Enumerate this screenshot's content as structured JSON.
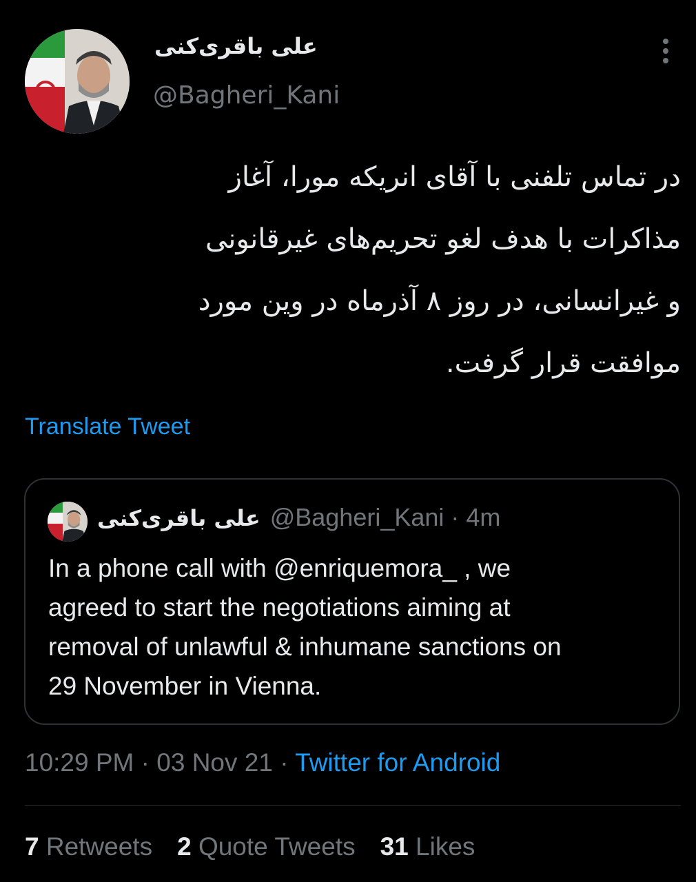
{
  "tweet": {
    "author": {
      "display_name": "علی باقری‌کنی",
      "handle": "@Bagheri_Kani"
    },
    "text_lines": [
      "در تماس تلفنی با آقای انریکه مورا، آغاز",
      "مذاکرات با هدف لغو تحریم‌های غیرقانونی",
      "و غیرانسانی، در روز ۸ آذرماه در وین مورد",
      "موافقت قرار گرفت."
    ],
    "translate_label": "Translate Tweet",
    "quoted": {
      "display_name": "علی باقری‌کنی",
      "handle": "@Bagheri_Kani",
      "separator": "·",
      "time": "4m",
      "text_lines": [
        "In a phone call with @enriquemora_ , we",
        "agreed to start the negotiations aiming at",
        "removal of unlawful & inhumane sanctions on",
        "29 November in Vienna."
      ]
    },
    "meta": {
      "time": "10:29 PM",
      "sep1": " · ",
      "date": "03 Nov 21",
      "sep2": " · ",
      "source": "Twitter for Android"
    },
    "stats": {
      "retweets_count": "7",
      "retweets_label": "Retweets",
      "quotes_count": "2",
      "quotes_label": "Quote Tweets",
      "likes_count": "31",
      "likes_label": "Likes"
    }
  },
  "icons": {
    "more": "more-vertical-icon"
  },
  "colors": {
    "background": "#000000",
    "text": "#e7e9ea",
    "secondary": "#71767b",
    "accent": "#1d9bf0",
    "border": "#2f3336"
  }
}
